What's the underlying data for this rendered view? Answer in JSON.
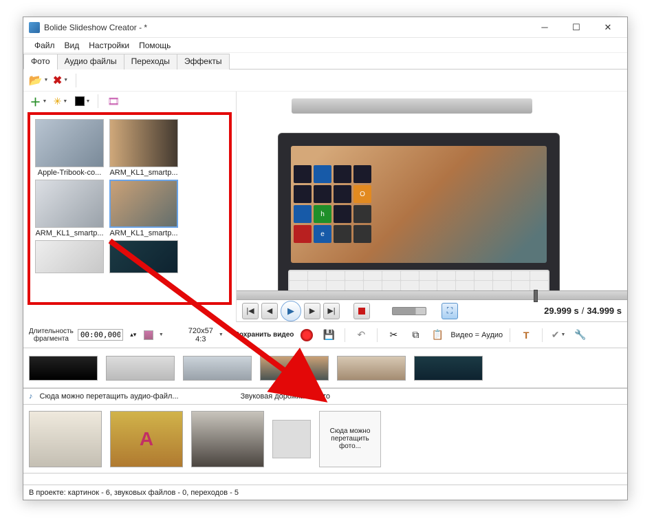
{
  "window": {
    "title": "Bolide Slideshow Creator - *"
  },
  "menu": {
    "file": "Файл",
    "view": "Вид",
    "settings": "Настройки",
    "help": "Помощь"
  },
  "tabs": {
    "photo": "Фото",
    "audio": "Аудио файлы",
    "transitions": "Переходы",
    "effects": "Эффекты"
  },
  "thumbs": [
    {
      "caption": "Apple-Tribook-co..."
    },
    {
      "caption": "ARM_KL1_smartp..."
    },
    {
      "caption": "ARM_KL1_smartp..."
    },
    {
      "caption": "ARM_KL1_smartp...",
      "selected": true
    }
  ],
  "playback": {
    "current": "29.999 s",
    "sep": "/",
    "total": "34.999 s"
  },
  "project": {
    "duration_label": "Длительность\nфрагмента",
    "duration_value": "00:00,000",
    "resolution": "720x57",
    "aspect": "4:3",
    "save_label": "Сохранить\nвидео",
    "va_label": "Видео = Аудио"
  },
  "audio_track": {
    "hint": "Сюда можно перетащить аудио-файл...",
    "status": "Звуковая дорожка - пусто"
  },
  "drop_hint": "Сюда можно перетащить фото...",
  "statusbar": "В проекте: картинок - 6, звуковых файлов - 0, переходов - 5"
}
